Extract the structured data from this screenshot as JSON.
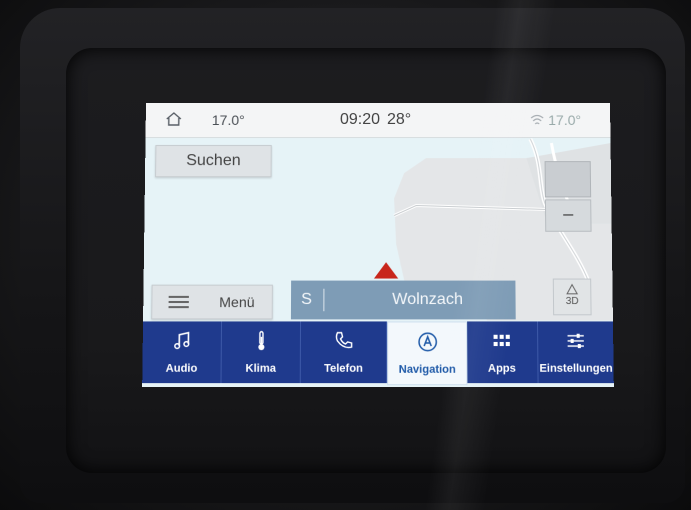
{
  "status_bar": {
    "outside_temp": "17.0°",
    "time": "09:20",
    "cabin_temp": "28°",
    "wifi_temp": "17.0°"
  },
  "map": {
    "search_label": "Suchen",
    "menu_label": "Menü",
    "zoom_out_label": "–",
    "view_3d_label": "3D",
    "destination_prefix": "S",
    "destination_name": "Wolnzach"
  },
  "nav_tabs": [
    {
      "label": "Audio",
      "icon": "music-note-icon"
    },
    {
      "label": "Klima",
      "icon": "thermometer-icon"
    },
    {
      "label": "Telefon",
      "icon": "phone-icon"
    },
    {
      "label": "Navigation",
      "icon": "navigation-icon",
      "active": true
    },
    {
      "label": "Apps",
      "icon": "apps-grid-icon"
    },
    {
      "label": "Einstellungen",
      "icon": "sliders-icon"
    }
  ],
  "colors": {
    "navbar": "#1f3a8d",
    "destination_bar": "#7e9cb6",
    "vehicle_arrow": "#c8261b"
  }
}
